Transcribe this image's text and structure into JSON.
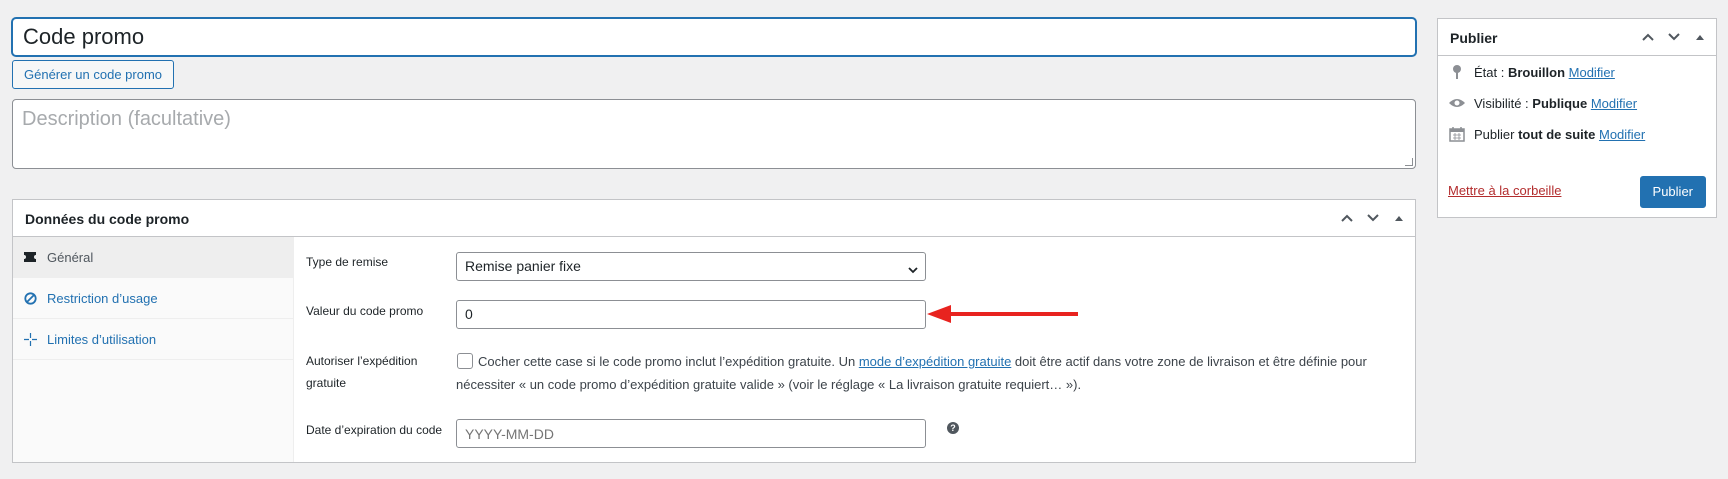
{
  "post": {
    "title_value": "Code promo",
    "generate_label": "Générer un code promo",
    "description_placeholder": "Description (facultative)"
  },
  "coupon_panel": {
    "title": "Données du code promo",
    "tabs": [
      {
        "label": "Général",
        "icon": "ticket-icon",
        "active": true
      },
      {
        "label": "Restriction d’usage",
        "icon": "block-icon",
        "active": false
      },
      {
        "label": "Limites d’utilisation",
        "icon": "crosshair-icon",
        "active": false
      }
    ],
    "fields": {
      "discount_type_label": "Type de remise",
      "discount_type_value": "Remise panier fixe",
      "amount_label": "Valeur du code promo",
      "amount_value": "0",
      "free_shipping_label": "Autoriser l’expédition gratuite",
      "free_shipping_text_before": "Cocher cette case si le code promo inclut l’expédition gratuite. Un ",
      "free_shipping_link": "mode d’expédition gratuite",
      "free_shipping_text_after": " doit être actif dans votre zone de livraison et être définie pour nécessiter « un code promo d’expédition gratuite valide » (voir le réglage « La livraison gratuite requiert… »).",
      "expiry_label": "Date d’expiration du code",
      "expiry_placeholder": "YYYY-MM-DD",
      "help_symbol": "?"
    }
  },
  "publish": {
    "title": "Publier",
    "status_label": "État : ",
    "status_value": "Brouillon",
    "visibility_label": "Visibilité : ",
    "visibility_value": "Publique",
    "schedule_label": "Publier ",
    "schedule_value": "tout de suite",
    "edit_link": "Modifier",
    "trash_link": "Mettre à la corbeille",
    "publish_button": "Publier"
  },
  "colors": {
    "accent": "#2271b1",
    "danger": "#b32d2e",
    "annotation_arrow": "#e8231f"
  }
}
